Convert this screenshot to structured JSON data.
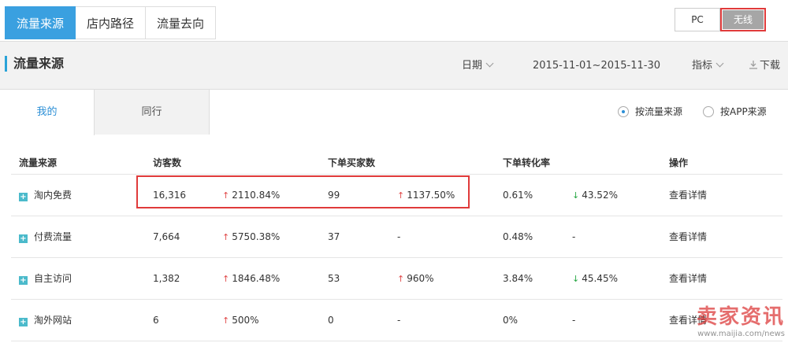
{
  "top_tabs": [
    "流量来源",
    "店内路径",
    "流量去向"
  ],
  "device": {
    "pc": "PC",
    "wireless": "无线"
  },
  "header": {
    "title": "流量来源",
    "date_label": "日期",
    "date_range": "2015-11-01~2015-11-30",
    "metric_label": "指标",
    "download_label": "下载"
  },
  "sub_tabs": {
    "mine": "我的",
    "peer": "同行"
  },
  "radios": {
    "traffic": "按流量来源",
    "app": "按APP来源"
  },
  "table": {
    "headers": [
      "流量来源",
      "访客数",
      "下单买家数",
      "下单转化率",
      "操作"
    ],
    "rows": [
      {
        "source": "淘内免费",
        "visitors": "16,316",
        "visitors_change": "2110.84%",
        "visitors_dir": "up",
        "buyers": "99",
        "buyers_change": "1137.50%",
        "buyers_dir": "up",
        "rate": "0.61%",
        "rate_change": "43.52%",
        "rate_dir": "down",
        "action": "查看详情"
      },
      {
        "source": "付费流量",
        "visitors": "7,664",
        "visitors_change": "5750.38%",
        "visitors_dir": "up",
        "buyers": "37",
        "buyers_change": "-",
        "buyers_dir": "none",
        "rate": "0.48%",
        "rate_change": "-",
        "rate_dir": "none",
        "action": "查看详情"
      },
      {
        "source": "自主访问",
        "visitors": "1,382",
        "visitors_change": "1846.48%",
        "visitors_dir": "up",
        "buyers": "53",
        "buyers_change": "960%",
        "buyers_dir": "up",
        "rate": "3.84%",
        "rate_change": "45.45%",
        "rate_dir": "down",
        "action": "查看详情"
      },
      {
        "source": "淘外网站",
        "visitors": "6",
        "visitors_change": "500%",
        "visitors_dir": "up",
        "buyers": "0",
        "buyers_change": "-",
        "buyers_dir": "none",
        "rate": "0%",
        "rate_change": "-",
        "rate_dir": "none",
        "action": "查看详情"
      }
    ]
  },
  "watermark": {
    "main": "卖家资讯",
    "url": "www.maijia.com/news"
  },
  "colors": {
    "accent": "#3aa0e0",
    "up": "#e04a4a",
    "down": "#28a745",
    "highlight": "#e03b3b"
  }
}
